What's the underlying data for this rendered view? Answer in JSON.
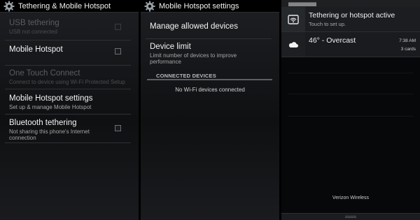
{
  "panel1": {
    "title": "Tethering & Mobile Hotspot",
    "items": [
      {
        "title": "USB tethering",
        "subtitle": "USB not connected"
      },
      {
        "title": "Mobile Hotspot",
        "subtitle": ""
      },
      {
        "title": "One Touch Connect",
        "subtitle": "Connect to device using Wi-Fi Protected Setup"
      },
      {
        "title": "Mobile Hotspot settings",
        "subtitle": "Set up & manage Mobile Hotspot"
      },
      {
        "title": "Bluetooth tethering",
        "subtitle": "Not sharing this phone's Internet connection"
      }
    ]
  },
  "panel2": {
    "title": "Mobile Hotspot settings",
    "items": [
      {
        "title": "Manage allowed devices",
        "subtitle": ""
      },
      {
        "title": "Device limit",
        "subtitle": "Limit number of devices to improve performance"
      }
    ],
    "section_header": "CONNECTED DEVICES",
    "empty_message": "No Wi-Fi devices connected"
  },
  "panel3": {
    "notifications": [
      {
        "title": "Tethering or hotspot active",
        "subtitle": "Touch to set up.",
        "time": "",
        "count": "",
        "icon": "wifi-hotspot-icon"
      },
      {
        "title": "46° - Overcast",
        "subtitle": "",
        "time": "7:38 AM",
        "count": "3 cards",
        "icon": "cloud-icon"
      }
    ],
    "carrier": "Verizon Wireless"
  }
}
